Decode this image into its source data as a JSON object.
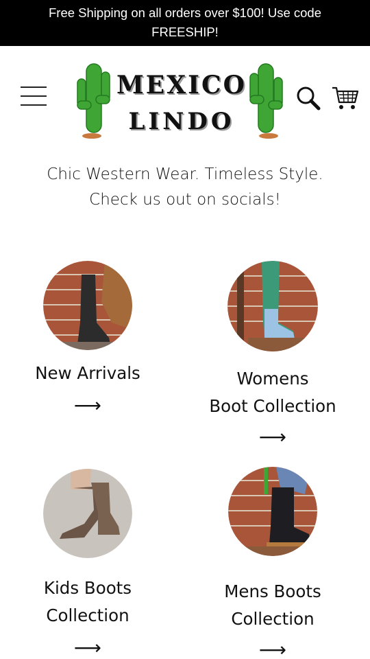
{
  "announcement": {
    "text": "Free Shipping on all orders over $100! Use code FREESHIP!"
  },
  "header": {
    "logo_line1": "MEXICO",
    "logo_line2": "LINDO",
    "menu_icon": "hamburger-menu-icon",
    "search_icon": "search-icon",
    "cart_icon": "shopping-cart-icon"
  },
  "tagline": {
    "line1": "Chic Western Wear. Timeless Style.",
    "line2": "Check us out on socials!"
  },
  "collections": [
    {
      "label_line1": "New Arrivals",
      "label_line2": "",
      "arrow": "⟶"
    },
    {
      "label_line1": "Womens",
      "label_line2": "Boot Collection",
      "arrow": "⟶"
    },
    {
      "label_line1": "Kids Boots",
      "label_line2": "Collection",
      "arrow": "⟶"
    },
    {
      "label_line1": "Mens Boots",
      "label_line2": "Collection",
      "arrow": "⟶"
    }
  ],
  "colors": {
    "announcement_bg": "#000000",
    "cactus_green": "#3fa535",
    "brick": "#a8553a"
  }
}
